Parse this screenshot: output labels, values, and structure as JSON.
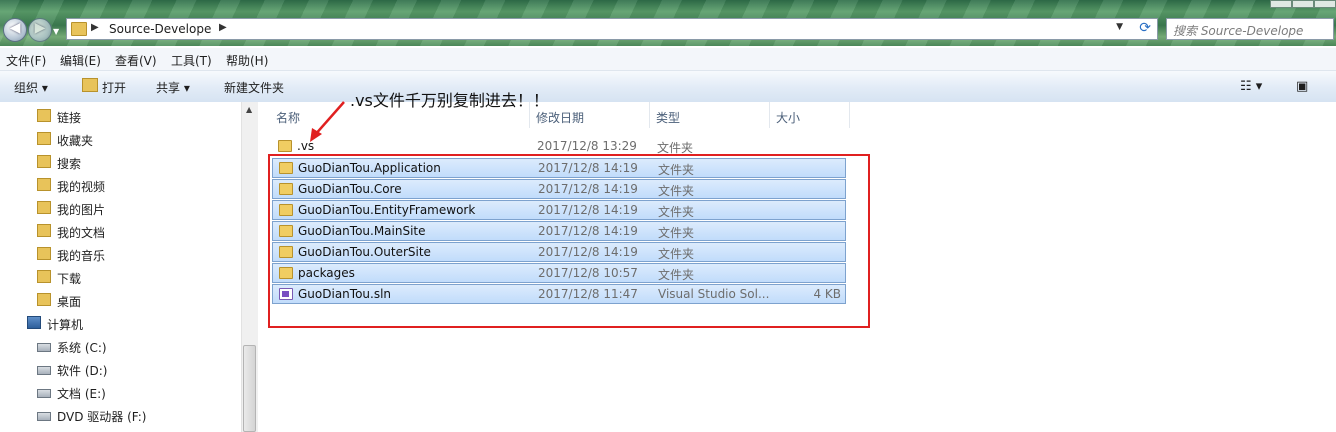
{
  "address": {
    "path": "Source-Develope"
  },
  "search": {
    "placeholder": "搜索 Source-Develope"
  },
  "menu": [
    "文件(F)",
    "编辑(E)",
    "查看(V)",
    "工具(T)",
    "帮助(H)"
  ],
  "toolbar": {
    "organize": "组织 ▾",
    "open": "打开",
    "share": "共享 ▾",
    "new_folder": "新建文件夹"
  },
  "nav": [
    {
      "label": "链接",
      "icon": "folder-icon"
    },
    {
      "label": "收藏夹",
      "icon": "folder-icon"
    },
    {
      "label": "搜索",
      "icon": "folder-icon"
    },
    {
      "label": "我的视频",
      "icon": "folder-icon"
    },
    {
      "label": "我的图片",
      "icon": "folder-icon"
    },
    {
      "label": "我的文档",
      "icon": "folder-icon"
    },
    {
      "label": "我的音乐",
      "icon": "folder-icon"
    },
    {
      "label": "下载",
      "icon": "folder-icon"
    },
    {
      "label": "桌面",
      "icon": "folder-icon"
    },
    {
      "label": "计算机",
      "icon": "computer-icon"
    },
    {
      "label": "系统 (C:)",
      "icon": "drive-icon"
    },
    {
      "label": "软件 (D:)",
      "icon": "drive-icon"
    },
    {
      "label": "文档 (E:)",
      "icon": "drive-icon"
    },
    {
      "label": "DVD 驱动器 (F:)",
      "icon": "dvd-icon"
    }
  ],
  "columns": {
    "name": "名称",
    "date": "修改日期",
    "type": "类型",
    "size": "大小"
  },
  "files": [
    {
      "name": ".vs",
      "date": "2017/12/8 13:29",
      "type": "文件夹",
      "size": ""
    },
    {
      "name": "GuoDianTou.Application",
      "date": "2017/12/8 14:19",
      "type": "文件夹",
      "size": ""
    },
    {
      "name": "GuoDianTou.Core",
      "date": "2017/12/8 14:19",
      "type": "文件夹",
      "size": ""
    },
    {
      "name": "GuoDianTou.EntityFramework",
      "date": "2017/12/8 14:19",
      "type": "文件夹",
      "size": ""
    },
    {
      "name": "GuoDianTou.MainSite",
      "date": "2017/12/8 14:19",
      "type": "文件夹",
      "size": ""
    },
    {
      "name": "GuoDianTou.OuterSite",
      "date": "2017/12/8 14:19",
      "type": "文件夹",
      "size": ""
    },
    {
      "name": "packages",
      "date": "2017/12/8 10:57",
      "type": "文件夹",
      "size": ""
    },
    {
      "name": "GuoDianTou.sln",
      "date": "2017/12/8 11:47",
      "type": "Visual Studio Sol...",
      "size": "4 KB"
    }
  ],
  "annotation": ".vs文件千万别复制进去！！",
  "colors": {
    "selection": "#c1dcfb",
    "highlight_box": "#e02020"
  }
}
